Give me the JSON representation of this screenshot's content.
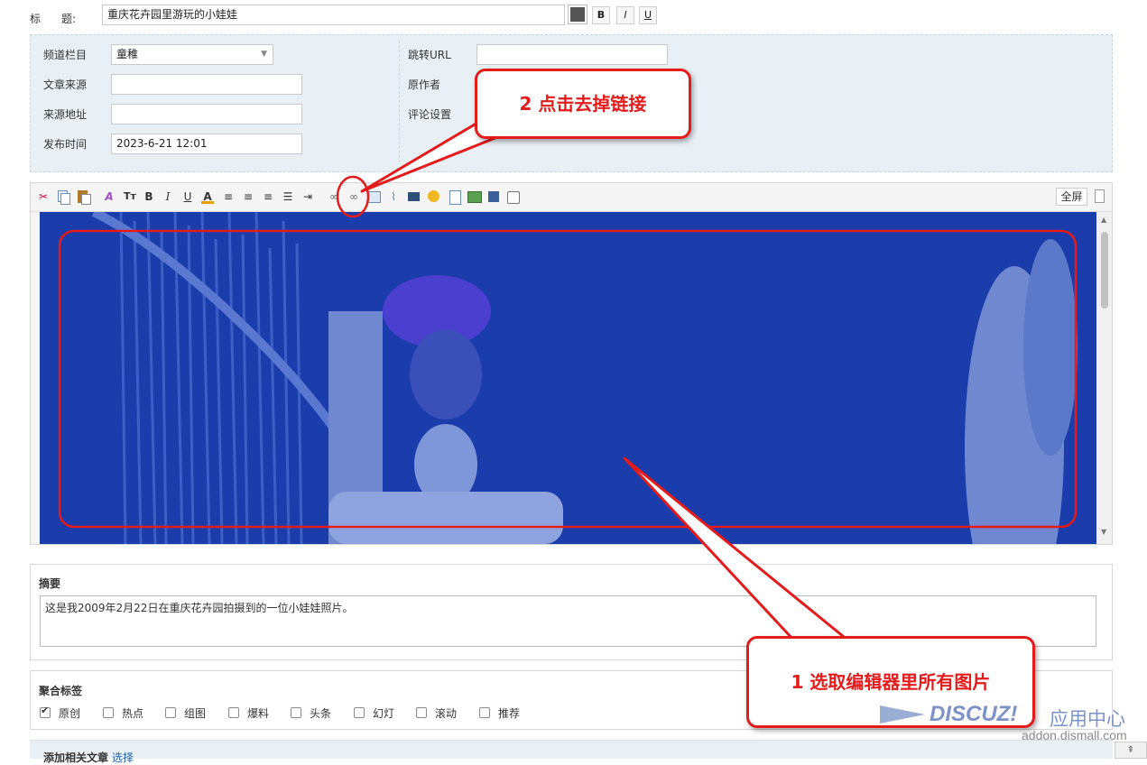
{
  "title_row": {
    "label_1": "标",
    "label_2": "题:",
    "value": "重庆花卉园里游玩的小娃娃",
    "bold": "B",
    "italic": "I",
    "underline": "U"
  },
  "meta": {
    "channel_label": "频道栏目",
    "channel_value": "童稚",
    "source_label": "文章来源",
    "source_value": "",
    "source_url_label": "来源地址",
    "source_url_value": "",
    "publish_label": "发布时间",
    "publish_value": "2023-6-21 12:01",
    "redirect_label": "跳转URL",
    "redirect_value": "",
    "author_label": "原作者",
    "comment_label": "评论设置"
  },
  "editor": {
    "fullscreen": "全屏",
    "toolbar_icons": [
      "cut-icon",
      "copy-icon",
      "paste-icon",
      "font-icon",
      "font-size-icon",
      "bold-icon",
      "italic-icon",
      "underline-icon",
      "font-color-icon",
      "align-left-icon",
      "align-center-icon",
      "align-right-icon",
      "ordered-list-icon",
      "indent-icon",
      "link-icon",
      "unlink-icon",
      "image-icon",
      "attach-icon",
      "video-icon",
      "emoji-icon",
      "page-icon",
      "insert-image-icon",
      "save-icon",
      "checkbox-icon"
    ]
  },
  "summary": {
    "label": "摘要",
    "text": "这是我2009年2月22日在重庆花卉园拍摄到的一位小娃娃照片。"
  },
  "tags": {
    "label": "聚合标签",
    "items": [
      {
        "label": "原创",
        "checked": true
      },
      {
        "label": "热点",
        "checked": false
      },
      {
        "label": "组图",
        "checked": false
      },
      {
        "label": "爆料",
        "checked": false
      },
      {
        "label": "头条",
        "checked": false
      },
      {
        "label": "幻灯",
        "checked": false
      },
      {
        "label": "滚动",
        "checked": false
      },
      {
        "label": "推荐",
        "checked": false
      }
    ]
  },
  "related": {
    "label": "添加相关文章",
    "link": "选择"
  },
  "annotations": {
    "callout_unlink": "2 点击去掉链接",
    "callout_select": "1 选取编辑器里所有图片"
  },
  "watermark": {
    "brand": "DISCUZ!",
    "suffix": "应用中心",
    "url": "addon.dismall.com"
  },
  "colors": {
    "accent_red": "#e31b1b",
    "selection_blue": "#1f3fb0",
    "panel_bg": "#e9f0f5"
  }
}
